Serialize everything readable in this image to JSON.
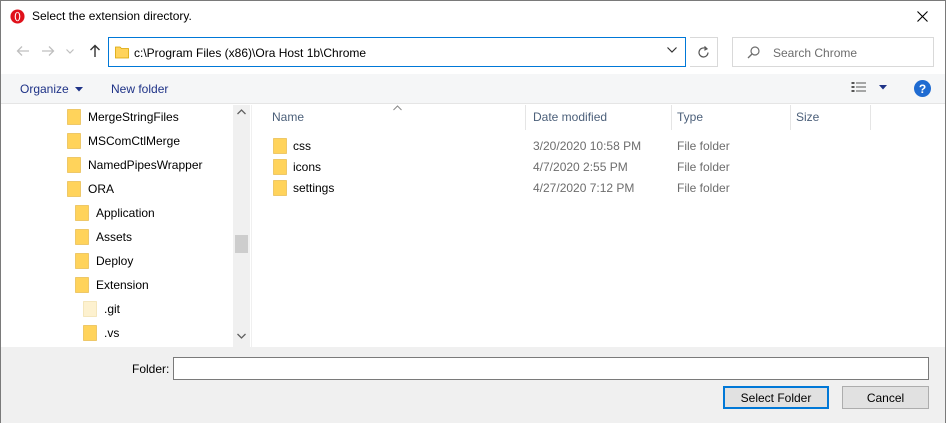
{
  "window": {
    "title": "Select the extension directory.",
    "close_glyph": "✕"
  },
  "address": {
    "path": "c:\\Program Files (x86)\\Ora Host 1b\\Chrome"
  },
  "search": {
    "placeholder": "Search Chrome"
  },
  "toolbar": {
    "organize_label": "Organize",
    "new_folder_label": "New folder",
    "help_glyph": "?"
  },
  "tree": {
    "items": [
      {
        "label": "MergeStringFiles",
        "level": 0
      },
      {
        "label": "MSComCtlMerge",
        "level": 0
      },
      {
        "label": "NamedPipesWrapper",
        "level": 0
      },
      {
        "label": "ORA",
        "level": 0
      },
      {
        "label": "Application",
        "level": 1
      },
      {
        "label": "Assets",
        "level": 1
      },
      {
        "label": "Deploy",
        "level": 1
      },
      {
        "label": "Extension",
        "level": 1
      },
      {
        "label": ".git",
        "level": 2,
        "hidden": true
      },
      {
        "label": ".vs",
        "level": 2
      }
    ]
  },
  "columns": {
    "name": "Name",
    "date": "Date modified",
    "type": "Type",
    "size": "Size"
  },
  "files": [
    {
      "name": "css",
      "date": "3/20/2020 10:58 PM",
      "type": "File folder"
    },
    {
      "name": "icons",
      "date": "4/7/2020 2:55 PM",
      "type": "File folder"
    },
    {
      "name": "settings",
      "date": "4/27/2020 7:12 PM",
      "type": "File folder"
    }
  ],
  "footer": {
    "folder_label": "Folder:",
    "folder_value": "",
    "select_button": "Select Folder",
    "cancel_button": "Cancel"
  },
  "colors": {
    "accent": "#0078d7",
    "folder": "#ffd35b",
    "link_blue": "#1e3287",
    "help_blue": "#1f6bd1"
  }
}
